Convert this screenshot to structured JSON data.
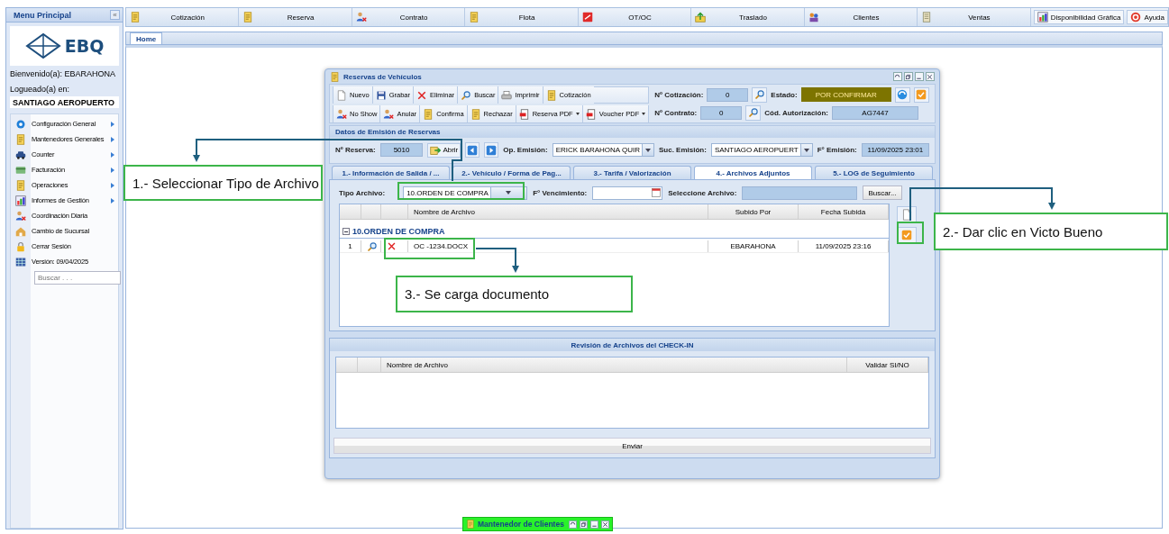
{
  "sidebar": {
    "title": "Menu Principal",
    "collapse_button": "«",
    "logo_text": "EBQ",
    "welcome": "Bienvenido(a): EBARAHONA",
    "logged_label": "Logueado(a) en:",
    "branch": "SANTIAGO AEROPUERTO",
    "items": [
      {
        "label": "Configuración General",
        "submenu": true
      },
      {
        "label": "Mantenedores Generales",
        "submenu": true
      },
      {
        "label": "Counter",
        "submenu": true
      },
      {
        "label": "Facturación",
        "submenu": true
      },
      {
        "label": "Operaciones",
        "submenu": true
      },
      {
        "label": "Informes de Gestión",
        "submenu": true
      },
      {
        "label": "Coordinación Diaria",
        "submenu": false
      },
      {
        "label": "Cambio de Sucursal",
        "submenu": false
      },
      {
        "label": "Cerrar Sesión",
        "submenu": false
      },
      {
        "label": "Versión: 09/04/2025",
        "submenu": false
      }
    ],
    "search": {
      "placeholder": "Buscar . . ."
    }
  },
  "toolbar": {
    "items": [
      {
        "label": "Cotización"
      },
      {
        "label": "Reserva"
      },
      {
        "label": "Contrato"
      },
      {
        "label": "Flota"
      },
      {
        "label": "OT/OC"
      },
      {
        "label": "Traslado"
      },
      {
        "label": "Clientes"
      },
      {
        "label": "Ventas"
      }
    ],
    "buttons": [
      {
        "label": "Disponibilidad Gráfica"
      },
      {
        "label": "Ayuda"
      }
    ]
  },
  "tabs": [
    {
      "label": "Home",
      "selected": true
    }
  ],
  "dialog": {
    "title": "Reservas de Vehículos",
    "action_rows": [
      [
        {
          "label": "Nuevo",
          "menu": false
        },
        {
          "label": "Grabar",
          "menu": false
        },
        {
          "label": "Eliminar",
          "menu": false
        },
        {
          "label": "Buscar",
          "menu": false
        },
        {
          "label": "Imprimir",
          "menu": false
        },
        {
          "label": "Cotización",
          "menu": false
        }
      ],
      [
        {
          "label": "No Show",
          "menu": false
        },
        {
          "label": "Anular",
          "menu": false
        },
        {
          "label": "Confirma",
          "menu": false
        },
        {
          "label": "Rechazar",
          "menu": false
        },
        {
          "label": "Reserva PDF",
          "menu": true
        },
        {
          "label": "Voucher PDF",
          "menu": true
        }
      ]
    ],
    "quote": {
      "label": "Nº Cotización:",
      "value": "0"
    },
    "status": {
      "label": "Estado:",
      "value": "POR CONFIRMAR"
    },
    "contract": {
      "label": "Nº Contrato:",
      "value": "0"
    },
    "authorization": {
      "label": "Cód. Autorización:",
      "value": "AG7447"
    },
    "emission": {
      "title": "Datos de Emisión de Reservas",
      "reservation": {
        "label": "Nº Reserva:",
        "value": "5010"
      },
      "open_button": "Abrir",
      "operator": {
        "label": "Op. Emisión:",
        "value": "ERICK BARAHONA QUIR"
      },
      "branch": {
        "label": "Suc. Emisión:",
        "value": "SANTIAGO AEROPUERT"
      },
      "date": {
        "label": "F° Emisión:",
        "value": "11/09/2025 23:01"
      }
    },
    "tabs": [
      {
        "label": "1.- Información de Salida / ...",
        "selected": false
      },
      {
        "label": "2.- Vehículo / Forma de Pag...",
        "selected": false
      },
      {
        "label": "3.- Tarifa / Valorización",
        "selected": false
      },
      {
        "label": "4.- Archivos Adjuntos",
        "selected": true
      },
      {
        "label": "5.- LOG de Seguimiento",
        "selected": false
      }
    ],
    "attachments": {
      "type": {
        "label": "Tipo Archivo:",
        "value": "10.ORDEN DE COMPRA"
      },
      "due": {
        "label": "F° Vencimiento:"
      },
      "file": {
        "label": "Seleccione Archivo:"
      },
      "browse_button": "Buscar...",
      "table": {
        "columns": [
          "Nombre de Archivo",
          "Subido Por",
          "Fecha Subida"
        ],
        "groups": [
          {
            "title": "10.ORDEN DE COMPRA",
            "expanded": true,
            "rows": [
              {
                "index": "1",
                "name": "OC -1234.DOCX",
                "uploaded_by": "EBARAHONA",
                "date": "11/09/2025 23:16"
              }
            ]
          }
        ]
      }
    },
    "checkin": {
      "title": "Revisión de Archivos del CHECK-IN",
      "columns": [
        "Nombre de Archivo",
        "Validar SI/NO"
      ],
      "send_button": "Enviar"
    }
  },
  "minimized_window": {
    "title": "Mantenedor de Clientes"
  },
  "annotations": [
    {
      "text": "1.- Seleccionar Tipo de Archivo"
    },
    {
      "text": "2.- Dar clic en Victo Bueno"
    },
    {
      "text": "3.- Se carga documento"
    }
  ]
}
